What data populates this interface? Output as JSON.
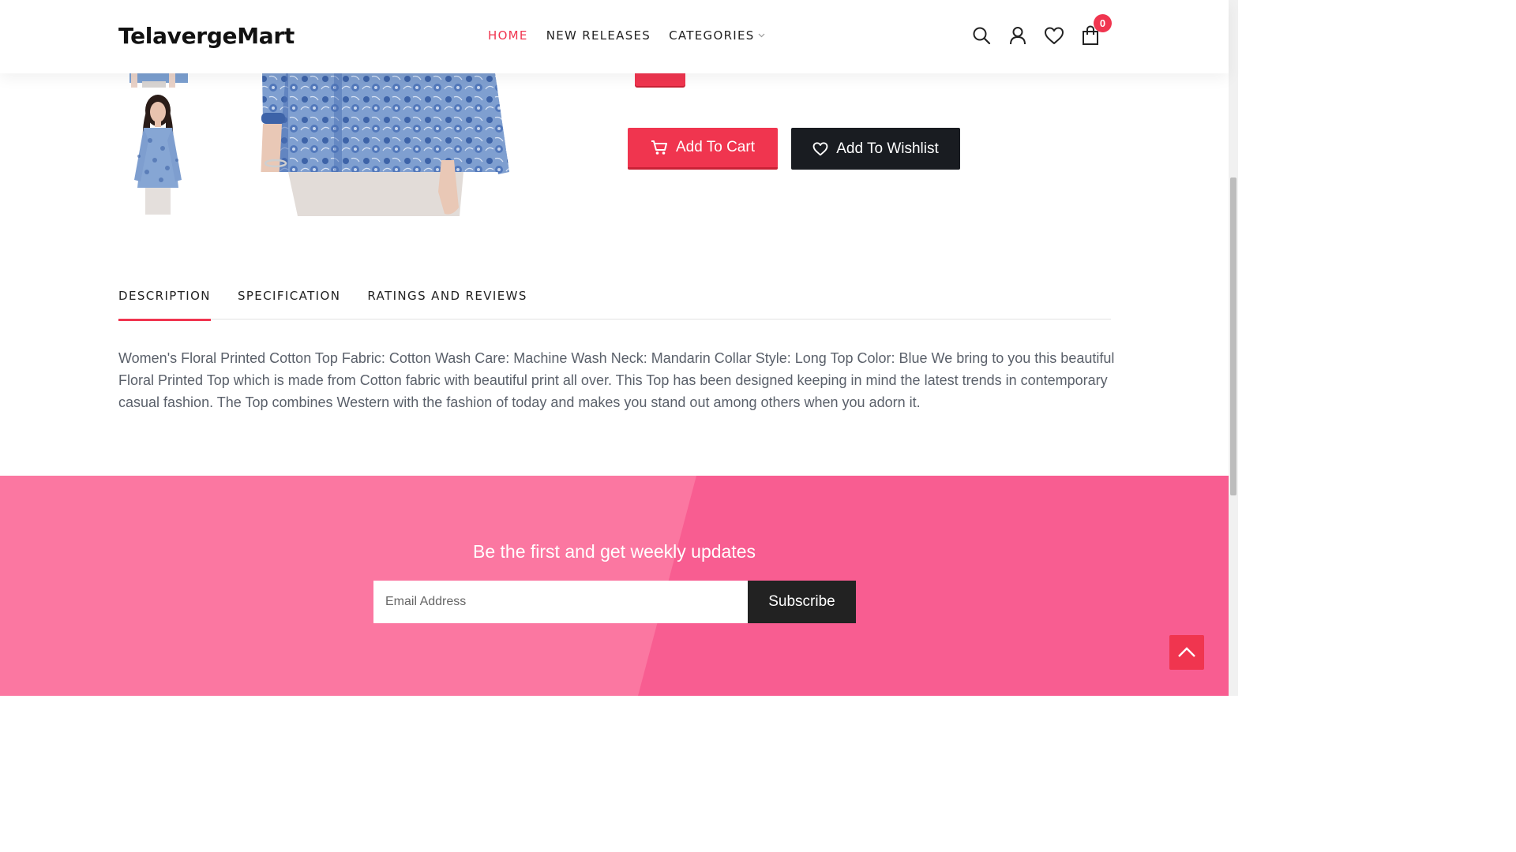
{
  "header": {
    "logo": "TelavergeMart",
    "nav": [
      {
        "label": "HOME",
        "active": true
      },
      {
        "label": "NEW RELEASES",
        "active": false
      },
      {
        "label": "CATEGORIES",
        "active": false
      }
    ],
    "icons": [
      "search-icon",
      "user-icon",
      "heart-icon",
      "shopping-bag-icon"
    ],
    "cart_count": "0"
  },
  "product": {
    "add_to_cart_label": "Add To Cart",
    "add_to_wishlist_label": "Add To Wishlist"
  },
  "tabs": [
    {
      "label": "DESCRIPTION",
      "active": true
    },
    {
      "label": "SPECIFICATION",
      "active": false
    },
    {
      "label": "RATINGS AND REVIEWS",
      "active": false
    }
  ],
  "description": "Women's Floral Printed Cotton Top Fabric: Cotton Wash Care: Machine Wash Neck: Mandarin Collar Style: Long Top Color: Blue We bring to you this beautiful Floral Printed Top which is made from Cotton fabric with beautiful print all over. This Top has been designed keeping in mind the latest trends in contemporary casual fashion. The Top combines Western with the fashion of today and makes you stand out among others when you adorn it.",
  "newsletter": {
    "title": "Be the first and get weekly updates",
    "email_placeholder": "Email Address",
    "subscribe_label": "Subscribe"
  },
  "colors": {
    "accent": "#f0354f",
    "dark_button": "#191c21",
    "newsletter_light": "#fb77a1",
    "newsletter_dark": "#f85d91"
  }
}
